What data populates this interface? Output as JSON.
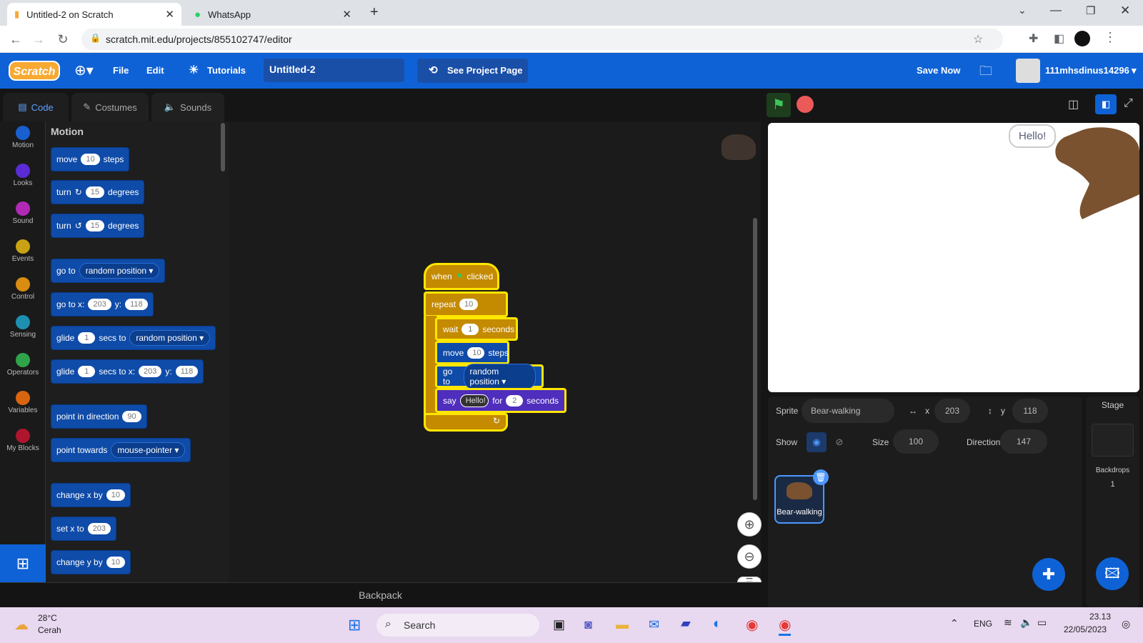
{
  "browser": {
    "tabs": [
      {
        "title": "Untitled-2 on Scratch",
        "icon": "scratch-cat-icon"
      },
      {
        "title": "WhatsApp",
        "icon": "whatsapp-icon"
      }
    ],
    "url": "scratch.mit.edu/projects/855102747/editor"
  },
  "menu": {
    "logo": "Scratch",
    "file": "File",
    "edit": "Edit",
    "tutorials": "Tutorials",
    "project_title": "Untitled-2",
    "see_project_page": "See Project Page",
    "save_now": "Save Now",
    "username": "111mhsdinus14296"
  },
  "editor_tabs": {
    "code": "Code",
    "costumes": "Costumes",
    "sounds": "Sounds"
  },
  "categories": [
    {
      "label": "Motion",
      "color": "#1a5fd0"
    },
    {
      "label": "Looks",
      "color": "#5b2bd6"
    },
    {
      "label": "Sound",
      "color": "#b02ab5"
    },
    {
      "label": "Events",
      "color": "#c9a213"
    },
    {
      "label": "Control",
      "color": "#d98c0f"
    },
    {
      "label": "Sensing",
      "color": "#1d8fb0"
    },
    {
      "label": "Operators",
      "color": "#2fa34a"
    },
    {
      "label": "Variables",
      "color": "#d9650f"
    },
    {
      "label": "My Blocks",
      "color": "#b0152e"
    }
  ],
  "palette": {
    "heading": "Motion",
    "move": {
      "a": "move",
      "v": "10",
      "b": "steps"
    },
    "turn_cw": {
      "a": "turn",
      "v": "15",
      "b": "degrees"
    },
    "turn_ccw": {
      "a": "turn",
      "v": "15",
      "b": "degrees"
    },
    "goto": {
      "a": "go to",
      "dd": "random position"
    },
    "gotoxy": {
      "a": "go to x:",
      "x": "203",
      "b": "y:",
      "y": "118"
    },
    "glide_to": {
      "a": "glide",
      "v": "1",
      "b": "secs to",
      "dd": "random position"
    },
    "glide_xy": {
      "a": "glide",
      "v": "1",
      "b": "secs to x:",
      "x": "203",
      "c": "y:",
      "y": "118"
    },
    "point_dir": {
      "a": "point in direction",
      "v": "90"
    },
    "point_towards": {
      "a": "point towards",
      "dd": "mouse-pointer"
    },
    "change_x": {
      "a": "change x by",
      "v": "10"
    },
    "set_x": {
      "a": "set x to",
      "v": "203"
    },
    "change_y": {
      "a": "change y by",
      "v": "10"
    }
  },
  "script": {
    "hat": {
      "a": "when",
      "b": "clicked"
    },
    "repeat": {
      "a": "repeat",
      "v": "10"
    },
    "wait": {
      "a": "wait",
      "v": "1",
      "b": "seconds"
    },
    "move": {
      "a": "move",
      "v": "10",
      "b": "steps"
    },
    "goto": {
      "a": "go to",
      "dd": "random position"
    },
    "say": {
      "a": "say",
      "msg": "Hello!",
      "b": "for",
      "v": "2",
      "c": "seconds"
    }
  },
  "backpack": "Backpack",
  "stage": {
    "speech": "Hello!"
  },
  "sprite_info": {
    "sprite_label": "Sprite",
    "sprite_name": "Bear-walking",
    "x_label": "x",
    "x": "203",
    "y_label": "y",
    "y": "118",
    "show_label": "Show",
    "size_label": "Size",
    "size": "100",
    "direction_label": "Direction",
    "direction": "147"
  },
  "sprites": [
    {
      "name": "Bear-walking"
    }
  ],
  "stage_panel": {
    "title": "Stage",
    "backdrops_label": "Backdrops",
    "backdrops_count": "1"
  },
  "taskbar": {
    "temp": "28°C",
    "weather": "Cerah",
    "search": "Search",
    "lang": "ENG",
    "time": "23.13",
    "date": "22/05/2023"
  }
}
